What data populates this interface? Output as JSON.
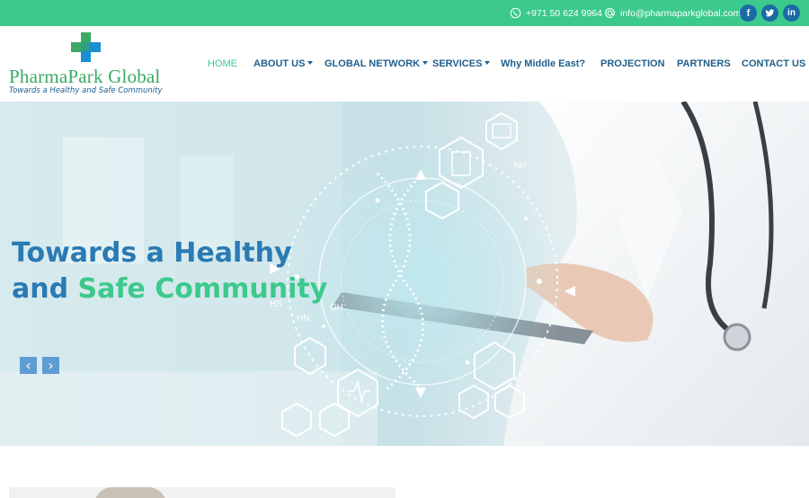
{
  "topbar": {
    "phone": "+971 50 624 9964",
    "email": "info@pharmaparkglobal.com",
    "social": [
      {
        "label": "f",
        "icon": "facebook-icon"
      },
      {
        "label": "t",
        "icon": "twitter-icon"
      },
      {
        "label": "in",
        "icon": "linkedin-icon"
      }
    ],
    "bg_color": "#3cc98c"
  },
  "logo": {
    "name": "PharmaPark Global",
    "tagline": "Towards a Healthy and Safe Community",
    "cross_colors": [
      "#3aaa64",
      "#1b8fd1"
    ]
  },
  "nav": {
    "items": [
      {
        "label": "HOME",
        "active": true
      },
      {
        "label": "ABOUT US",
        "dropdown": true
      },
      {
        "label": "GLOBAL NETWORK",
        "dropdown": true
      },
      {
        "label": "SERVICES",
        "dropdown": true
      },
      {
        "label": "Why Middle East?"
      },
      {
        "label": "PROJECTION"
      },
      {
        "label": "PARTNERS"
      },
      {
        "label": "CONTACT US"
      }
    ]
  },
  "hero": {
    "line1": "Towards a Healthy",
    "line2_a": "and ",
    "line2_b": "Safe Community",
    "overlay_labels": [
      "NH",
      "HS",
      "HN",
      "OH"
    ],
    "prev_label": "‹",
    "next_label": "›"
  }
}
